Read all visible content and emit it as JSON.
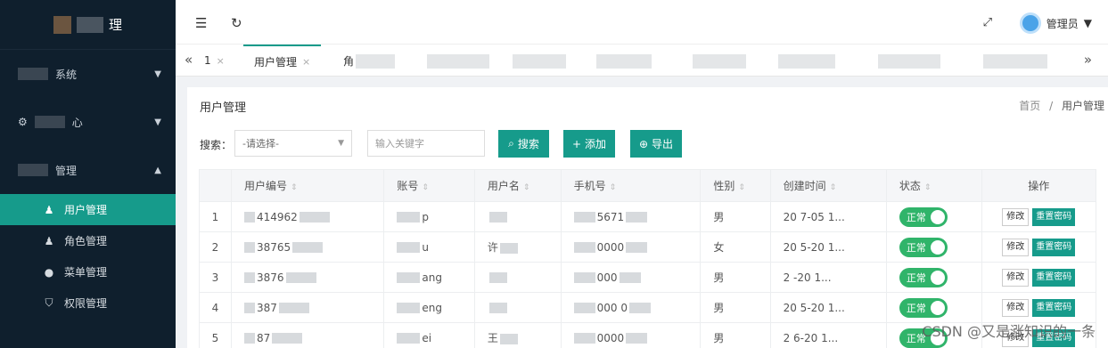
{
  "sidebar": {
    "logo_text": "理",
    "groups": [
      {
        "label": "系统",
        "caret": "▼"
      },
      {
        "label": "心",
        "caret": "▼"
      },
      {
        "label": "管理",
        "caret": "▲"
      }
    ],
    "items": [
      {
        "label": "用户管理",
        "icon": "person-icon",
        "glyph": "♟"
      },
      {
        "label": "角色管理",
        "icon": "person-icon",
        "glyph": "♟"
      },
      {
        "label": "菜单管理",
        "icon": "circle-icon",
        "glyph": "●"
      },
      {
        "label": "权限管理",
        "icon": "shield-icon",
        "glyph": "⛉"
      }
    ]
  },
  "topbar": {
    "collapse_glyph": "☰",
    "refresh_glyph": "↻",
    "fullscreen_glyph": "⤢",
    "user_name": "管理员",
    "user_caret": "▼"
  },
  "tabs": {
    "left_arrow": "«",
    "right_arrow": "»",
    "first_tab": "1",
    "active_tab": "用户管理",
    "second_tab": "角",
    "close_glyph": "×"
  },
  "panel": {
    "title": "用户管理",
    "breadcrumb": {
      "home": "首页",
      "separator": "/",
      "current": "用户管理"
    }
  },
  "search": {
    "label": "搜索：",
    "select_value": "-请选择-",
    "select_arrow": "▼",
    "keyword_placeholder": "输入关键字",
    "search_button": "搜索",
    "search_icon": "⌕",
    "add_button": "添加",
    "add_icon": "+",
    "export_button": "导出",
    "export_icon": "⊕"
  },
  "table": {
    "sort_glyph": "⇕",
    "columns": [
      "用户编号",
      "账号",
      "用户名",
      "手机号",
      "性别",
      "创建时间",
      "状态",
      "操作"
    ],
    "rows": [
      {
        "idx": "1",
        "id": "414962",
        "account": "p",
        "name": "",
        "phone": "5671",
        "gender": "男",
        "created": "20 7-05 1...",
        "status": "正常"
      },
      {
        "idx": "2",
        "id": "38765",
        "account": "u",
        "name": "许",
        "phone": "0000",
        "gender": "女",
        "created": "20 5-20 1...",
        "status": "正常"
      },
      {
        "idx": "3",
        "id": "3876",
        "account": "ang",
        "name": "",
        "phone": "000",
        "gender": "男",
        "created": "2 -20 1...",
        "status": "正常"
      },
      {
        "idx": "4",
        "id": "387",
        "account": "eng",
        "name": "",
        "phone": "000 0",
        "gender": "男",
        "created": "20 5-20 1...",
        "status": "正常"
      },
      {
        "idx": "5",
        "id": "87",
        "account": "ei",
        "name": "王",
        "phone": "0000",
        "gender": "男",
        "created": "2 6-20 1...",
        "status": "正常"
      }
    ],
    "edit_label": "修改",
    "reset_label": "重置密码"
  },
  "watermark": "CSDN @又是涨知识的一条"
}
